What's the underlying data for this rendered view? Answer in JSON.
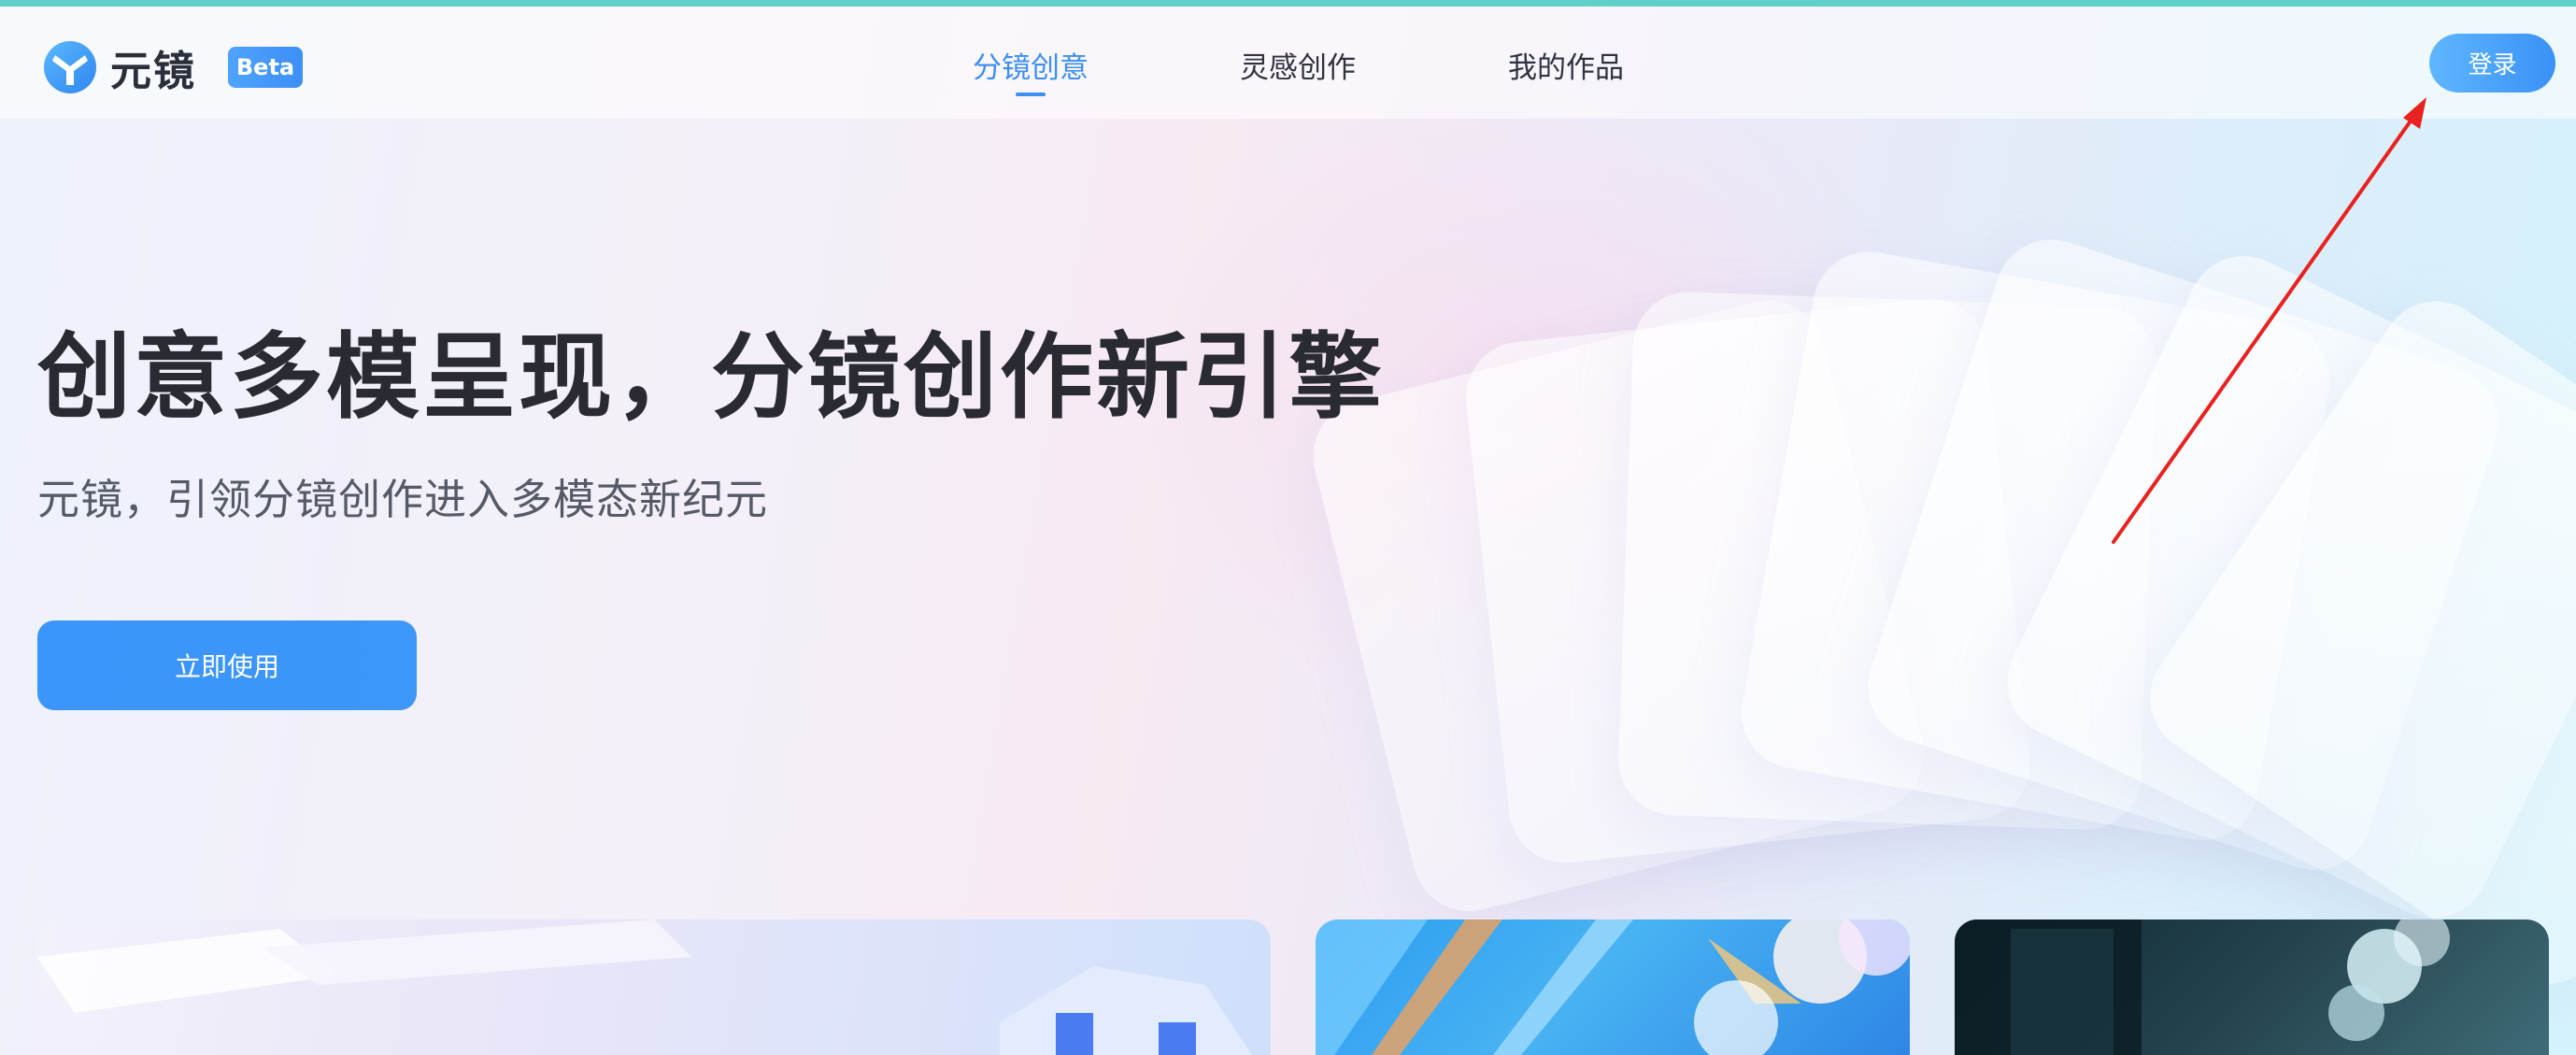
{
  "header": {
    "logo_text": "元镜",
    "beta_badge": "Beta",
    "nav": [
      {
        "label": "分镜创意",
        "active": true
      },
      {
        "label": "灵感创作",
        "active": false
      },
      {
        "label": "我的作品",
        "active": false
      }
    ],
    "login_label": "登录"
  },
  "hero": {
    "title": "创意多模呈现，分镜创作新引擎",
    "subtitle": "元镜，引领分镜创作进入多模态新纪元",
    "cta_label": "立即使用"
  },
  "colors": {
    "accent": "#3b8ff5",
    "title_text": "#2a2a33",
    "top_strip": "#5fd1c8",
    "annotation_arrow": "#e8221f"
  },
  "icons": {
    "logo": "yuanjing-logo-icon"
  }
}
